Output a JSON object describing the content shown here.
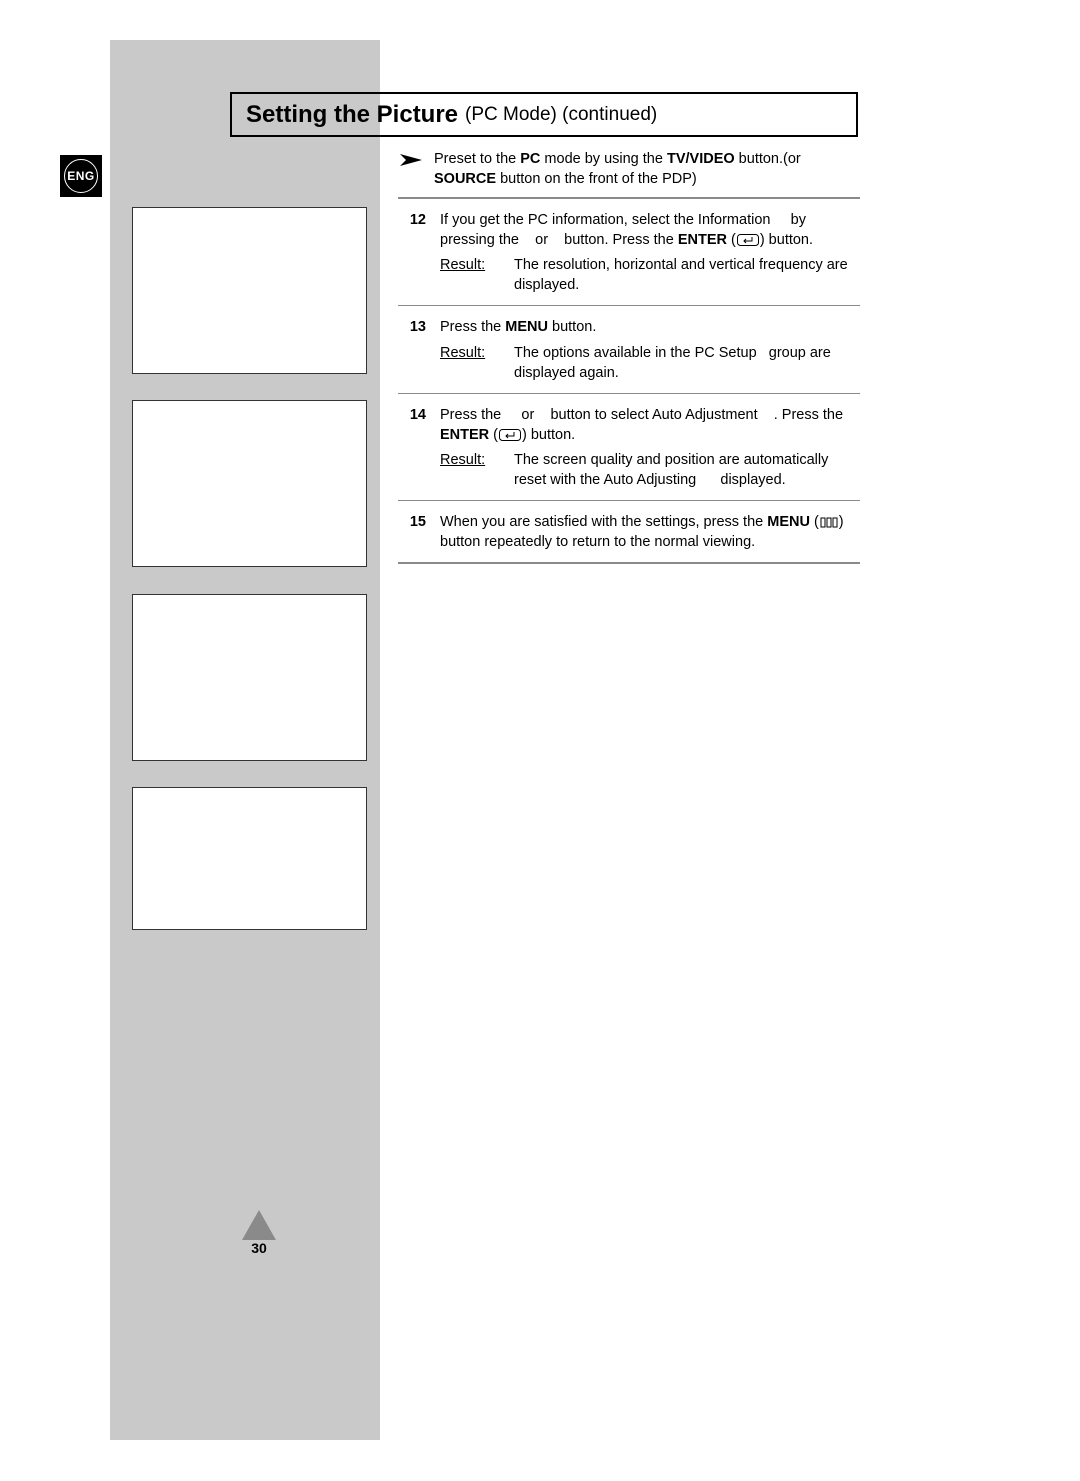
{
  "lang_badge": "ENG",
  "title_bold": "Setting the Picture",
  "title_rest": "(PC Mode)  (continued)",
  "preset": {
    "t1": "Preset to the ",
    "t2": "PC",
    "t3": " mode by using the ",
    "t4": "TV/VIDEO",
    "t5": " button.(or ",
    "t6": "SOURCE",
    "t7": " button on the front of the PDP)"
  },
  "s12": {
    "num": "12",
    "a1": "If you get the PC information, select the",
    "a2": "Information",
    "a3": "by pressing the",
    "a4": "or",
    "a5": "button. Press the ",
    "a6": "ENTER",
    "a7": " (",
    "a8": ") button.",
    "result_label": "Result:",
    "result_text": "The resolution, horizontal and vertical frequency are displayed."
  },
  "s13": {
    "num": "13",
    "a1": "Press the ",
    "a2": "MENU",
    "a3": " button.",
    "result_label": "Result:",
    "result_text_a": "The options available in the",
    "result_text_b": "PC Setup",
    "result_text_c": "group are displayed again."
  },
  "s14": {
    "num": "14",
    "a1": "Press the ",
    "a2": "or",
    "a3": "button to select",
    "a4": "Auto Adjustment",
    "a5": ". Press the ",
    "a6": "ENTER",
    "a7": " (",
    "a8": ") button.",
    "result_label": "Result:",
    "result_text_a": "The screen quality and position are automatically reset with the",
    "result_text_b": "Auto Adjusting",
    "result_text_c": "displayed."
  },
  "s15": {
    "num": "15",
    "a1": "When you are satisfied with the settings, press the ",
    "a2": "MENU",
    "a3": " (",
    "a4": ") button repeatedly to return to the normal viewing."
  },
  "page_number": "30"
}
